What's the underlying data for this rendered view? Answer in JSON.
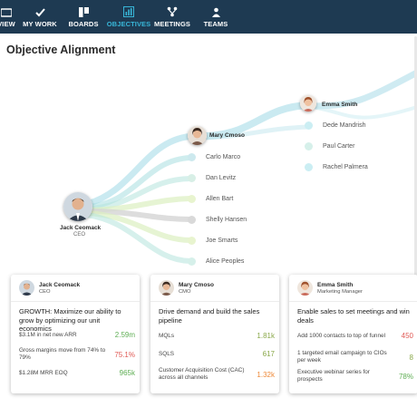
{
  "nav": {
    "items": [
      {
        "label": "VIEW",
        "icon": "view-icon"
      },
      {
        "label": "MY WORK",
        "icon": "check-icon"
      },
      {
        "label": "BOARDS",
        "icon": "boards-icon"
      },
      {
        "label": "OBJECTIVES",
        "icon": "bar-chart-icon",
        "active": true
      },
      {
        "label": "MEETINGS",
        "icon": "meetings-icon"
      },
      {
        "label": "TEAMS",
        "icon": "teams-icon"
      }
    ],
    "active_color": "#38b6d8",
    "background": "#1e3a52"
  },
  "page": {
    "title": "Objective Alignment"
  },
  "tree": {
    "root": {
      "name": "Jack Ceomack",
      "role": "CEO"
    },
    "mid": {
      "name": "Mary Cmoso"
    },
    "top": {
      "name": "Emma Smith"
    },
    "top_reports": [
      "Dede Mandrish",
      "Paul Carter",
      "Rachel Palmera"
    ],
    "reports": [
      "Carlo Marco",
      "Dan Levitz",
      "Allen Bart",
      "Shelly Hansen",
      "Joe Smarts",
      "Alice Peoples"
    ]
  },
  "cards": [
    {
      "name": "Jack Ceomack",
      "role": "CEO",
      "objective": "GROWTH: Maximize our ability to grow by optimizing our unit economics",
      "results": [
        {
          "text": "$3.1M in net new ARR",
          "value": "2.59m",
          "status": "green"
        },
        {
          "text": "Gross margins move from 74% to 79%",
          "value": "75.1%",
          "status": "red"
        },
        {
          "text": "$1.28M MRR EOQ",
          "value": "965k",
          "status": "green"
        }
      ]
    },
    {
      "name": "Mary Cmoso",
      "role": "CMO",
      "objective": "Drive demand and build the sales pipeline",
      "results": [
        {
          "text": "MQLs",
          "value": "1.81k",
          "status": "olive"
        },
        {
          "text": "SQLS",
          "value": "617",
          "status": "olive"
        },
        {
          "text": "Customer Acquisition Cost (CAC) across all channels",
          "value": "1.32k",
          "status": "orange"
        }
      ]
    },
    {
      "name": "Emma Smith",
      "role": "Marketing Manager",
      "objective": "Enable sales to set meetings and win deals",
      "results": [
        {
          "text": "Add 1000 contacts to top of funnel",
          "value": "450",
          "status": "red"
        },
        {
          "text": "1 targeted email campaign to CIOs per week",
          "value": "8",
          "status": "olive"
        },
        {
          "text": "Executive webinar series for prospects",
          "value": "78%",
          "status": "green"
        }
      ]
    }
  ]
}
